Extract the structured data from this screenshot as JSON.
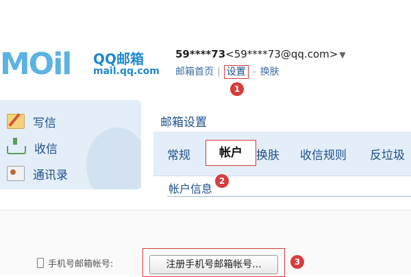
{
  "header": {
    "logo_main": "MOil",
    "logo_cn": "QQ邮箱",
    "logo_url": "mail.qq.com",
    "user_prefix": "59****",
    "user_bold": "73",
    "user_email": "<59****73@qq.com>",
    "links": {
      "home": "邮箱首页",
      "settings": "设置",
      "skin": "换肤",
      "sep": "|",
      "dash": "–"
    }
  },
  "nav": {
    "items": [
      {
        "label": "写信",
        "icon": "compose-icon"
      },
      {
        "label": "收信",
        "icon": "inbox-icon"
      },
      {
        "label": "通讯录",
        "icon": "contacts-icon"
      }
    ]
  },
  "settings": {
    "title": "邮箱设置",
    "tabs": [
      "常规",
      "帐户",
      "换肤",
      "收信规则",
      "反垃圾"
    ],
    "active_tab": "帐户",
    "section_title": "帐户信息"
  },
  "account": {
    "phone_label": "手机号邮箱帐号:",
    "register_button": "注册手机号邮箱帐号..."
  },
  "annotations": [
    "1",
    "2",
    "3"
  ],
  "colors": {
    "link": "#1d4f8c",
    "panel": "#e3eef8",
    "highlight": "#d43a3a",
    "logo": "#1e88d1"
  }
}
